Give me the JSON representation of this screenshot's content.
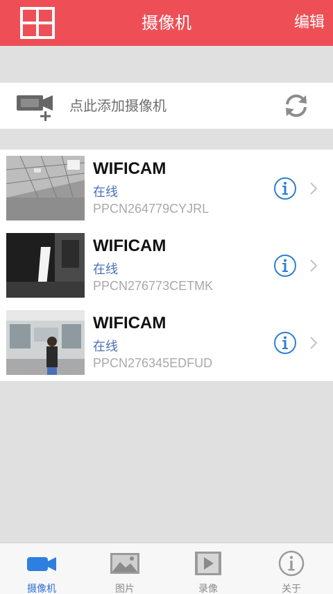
{
  "header": {
    "title": "摄像机",
    "edit_label": "编辑"
  },
  "add_camera": {
    "label": "点此添加摄像机"
  },
  "cameras": [
    {
      "name": "WIFICAM",
      "status": "在线",
      "uid": "PPCN264779CYJRL"
    },
    {
      "name": "WIFICAM",
      "status": "在线",
      "uid": "PPCN276773CETMK"
    },
    {
      "name": "WIFICAM",
      "status": "在线",
      "uid": "PPCN276345EDFUD"
    }
  ],
  "tabs": [
    {
      "label": "摄像机",
      "icon": "video-camera-icon",
      "active": true
    },
    {
      "label": "图片",
      "icon": "picture-icon",
      "active": false
    },
    {
      "label": "录像",
      "icon": "video-play-icon",
      "active": false
    },
    {
      "label": "关于",
      "icon": "info-icon",
      "active": false
    }
  ],
  "colors": {
    "header_bg": "#ee4f56",
    "accent_blue": "#2d6fd6",
    "status_blue": "#4a6fb8",
    "uid_gray": "#a9a9a9"
  }
}
